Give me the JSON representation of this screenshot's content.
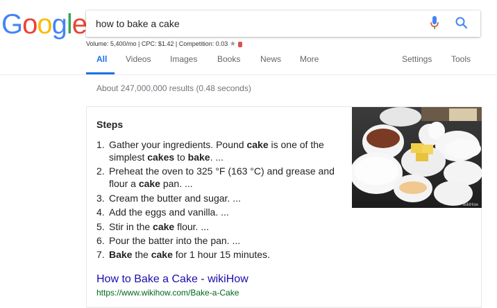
{
  "logo": {
    "letters": [
      "G",
      "o",
      "o",
      "g",
      "l",
      "e"
    ],
    "colors": [
      "#4285f4",
      "#ea4335",
      "#fbbc05",
      "#4285f4",
      "#34a853",
      "#ea4335"
    ]
  },
  "search": {
    "query": "how to bake a cake",
    "mic_icon": "microphone-icon",
    "search_icon": "search-icon"
  },
  "keyword_meta": {
    "volume": "Volume: 5,400/mo",
    "cpc": "CPC: $1.42",
    "competition": "Competition: 0.03"
  },
  "tabs": {
    "all": "All",
    "videos": "Videos",
    "images": "Images",
    "books": "Books",
    "news": "News",
    "more": "More",
    "settings": "Settings",
    "tools": "Tools"
  },
  "results": {
    "count": "About 247,000,000 results (0.48 seconds)"
  },
  "featured_snippet": {
    "heading": "Steps",
    "steps": [
      {
        "num": "1.",
        "parts": [
          [
            "Gather your ingredients. Pound ",
            false
          ],
          [
            "cake",
            true
          ],
          [
            " is one of the simplest ",
            false
          ],
          [
            "cakes",
            true
          ],
          [
            " to ",
            false
          ],
          [
            "bake",
            true
          ],
          [
            ". ...",
            false
          ]
        ]
      },
      {
        "num": "2.",
        "parts": [
          [
            "Preheat the oven to 325 °F (163 °C) and grease and flour a ",
            false
          ],
          [
            "cake",
            true
          ],
          [
            " pan. ...",
            false
          ]
        ]
      },
      {
        "num": "3.",
        "parts": [
          [
            "Cream the butter and sugar. ...",
            false
          ]
        ]
      },
      {
        "num": "4.",
        "parts": [
          [
            "Add the eggs and vanilla. ...",
            false
          ]
        ]
      },
      {
        "num": "5.",
        "parts": [
          [
            "Stir in the ",
            false
          ],
          [
            "cake",
            true
          ],
          [
            " flour. ...",
            false
          ]
        ]
      },
      {
        "num": "6.",
        "parts": [
          [
            "Pour the batter into the pan. ...",
            false
          ]
        ]
      },
      {
        "num": "7.",
        "parts": [
          [
            "Bake",
            true
          ],
          [
            " the ",
            false
          ],
          [
            "cake",
            true
          ],
          [
            " for 1 hour 15 minutes.",
            false
          ]
        ]
      }
    ],
    "image_watermark": "wikiHow",
    "link_title": "How to Bake a Cake - wikiHow",
    "link_url": "https://www.wikihow.com/Bake-a-Cake"
  }
}
